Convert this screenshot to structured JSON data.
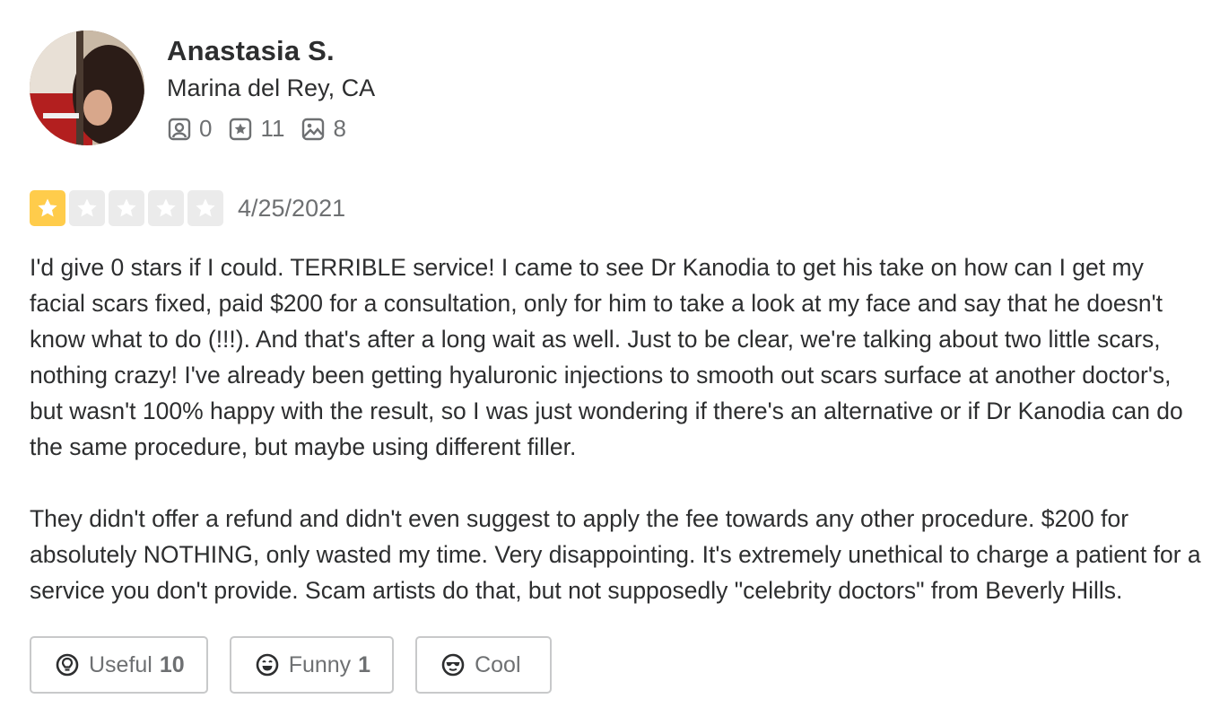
{
  "user": {
    "name": "Anastasia S.",
    "location": "Marina del Rey, CA",
    "stats": [
      {
        "icon": "friends-icon",
        "value": "0"
      },
      {
        "icon": "review-star-icon",
        "value": "11"
      },
      {
        "icon": "photo-icon",
        "value": "8"
      }
    ]
  },
  "review": {
    "rating": 1,
    "rating_max": 5,
    "date": "4/25/2021",
    "paragraphs": [
      "I'd give 0 stars if I could. TERRIBLE service! I came to see Dr Kanodia to get his take on how can I get my facial scars fixed, paid $200 for a consultation, only for him to take a look at my face and say that he doesn't know what to do (!!!). And that's after a long wait as well. Just to be clear, we're talking about two little scars, nothing crazy! I've already been getting hyaluronic injections to smooth out scars surface at another doctor's, but wasn't 100% happy with the result, so I was just wondering if there's an alternative or if Dr Kanodia can do the same procedure, but maybe using different filler.",
      "They didn't offer a refund and didn't even suggest to apply the fee towards any other procedure. $200 for absolutely NOTHING, only wasted my time. Very disappointing. It's extremely unethical to charge a patient for a service you don't provide. Scam artists do that, but not supposedly \"celebrity doctors\" from Beverly Hills."
    ]
  },
  "reactions": {
    "useful": {
      "label": "Useful",
      "count": "10"
    },
    "funny": {
      "label": "Funny",
      "count": "1"
    },
    "cool": {
      "label": "Cool",
      "count": ""
    }
  },
  "colors": {
    "star_filled": "#ffcc4b",
    "star_empty": "#ebebeb",
    "text_primary": "#2d2e2f",
    "text_secondary": "#6e7072"
  }
}
